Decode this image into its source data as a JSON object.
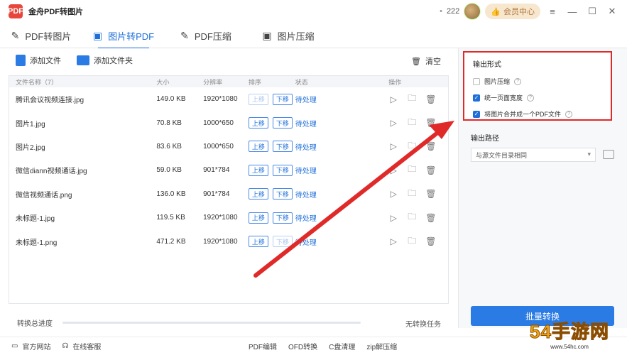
{
  "app": {
    "logo_text": "PDF",
    "title": "金舟PDF转图片",
    "points": "222",
    "vip_label": "会员中心"
  },
  "window_controls": {
    "menu": "≡",
    "minimize": "—",
    "maximize": "☐",
    "close": "✕"
  },
  "tabs": [
    {
      "label": "PDF转图片",
      "active": false,
      "icon": "pdf-to-image-icon"
    },
    {
      "label": "图片转PDF",
      "active": true,
      "icon": "image-to-pdf-icon"
    },
    {
      "label": "PDF压缩",
      "active": false,
      "icon": "pdf-compress-icon"
    },
    {
      "label": "图片压缩",
      "active": false,
      "icon": "image-compress-icon"
    }
  ],
  "toolbar": {
    "add_file": "添加文件",
    "add_folder": "添加文件夹",
    "clear": "清空"
  },
  "table": {
    "headers": {
      "name": "文件名称（7）",
      "size": "大小",
      "resolution": "分辨率",
      "order": "排序",
      "status": "状态",
      "ops": "操作"
    },
    "rows": [
      {
        "name": "腾讯会议视频连接.jpg",
        "size": "149.0 KB",
        "resolution": "1920*1080",
        "up": "上移",
        "down": "下移",
        "up_disabled": true,
        "down_disabled": false,
        "status": "待处理"
      },
      {
        "name": "图片1.jpg",
        "size": "70.8 KB",
        "resolution": "1000*650",
        "up": "上移",
        "down": "下移",
        "up_disabled": false,
        "down_disabled": false,
        "status": "待处理"
      },
      {
        "name": "图片2.jpg",
        "size": "83.6 KB",
        "resolution": "1000*650",
        "up": "上移",
        "down": "下移",
        "up_disabled": false,
        "down_disabled": false,
        "status": "待处理"
      },
      {
        "name": "微信diann视频通话.jpg",
        "size": "59.0 KB",
        "resolution": "901*784",
        "up": "上移",
        "down": "下移",
        "up_disabled": false,
        "down_disabled": false,
        "status": "待处理"
      },
      {
        "name": "微信视频通话.png",
        "size": "136.0 KB",
        "resolution": "901*784",
        "up": "上移",
        "down": "下移",
        "up_disabled": false,
        "down_disabled": false,
        "status": "待处理"
      },
      {
        "name": "未标题-1.jpg",
        "size": "119.5 KB",
        "resolution": "1920*1080",
        "up": "上移",
        "down": "下移",
        "up_disabled": false,
        "down_disabled": false,
        "status": "待处理"
      },
      {
        "name": "未标题-1.png",
        "size": "471.2 KB",
        "resolution": "1920*1080",
        "up": "上移",
        "down": "下移",
        "up_disabled": false,
        "down_disabled": true,
        "status": "待处理"
      }
    ]
  },
  "output": {
    "title": "输出形式",
    "options": [
      {
        "label": "图片压缩",
        "checked": false
      },
      {
        "label": "统一页面宽度",
        "checked": true
      },
      {
        "label": "将图片合并成一个PDF文件",
        "checked": true
      }
    ],
    "path_title": "输出路径",
    "path_value": "与源文件目录相同"
  },
  "convert_button": "批量转换",
  "progress": {
    "label": "转换总进度",
    "status": "无转换任务",
    "fraction": 0
  },
  "footer": {
    "official_site": "官方网站",
    "online_service": "在线客服",
    "links": [
      "PDF编辑",
      "OFD转换",
      "C盘清理",
      "zip解压缩"
    ]
  },
  "watermark": {
    "main": "54手游网",
    "sub": "www.54hc.com"
  },
  "colors": {
    "accent": "#1e6fd9",
    "highlight_box": "#e02a2a"
  }
}
